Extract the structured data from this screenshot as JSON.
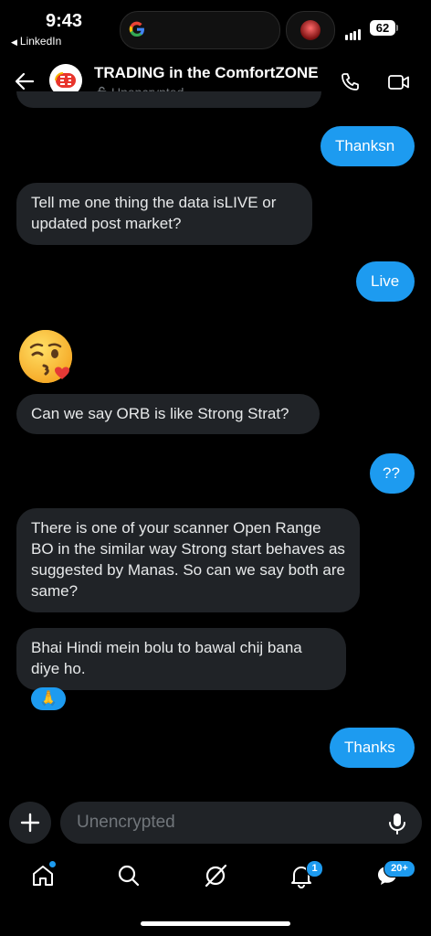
{
  "status_bar": {
    "time": "9:43",
    "back_app": "LinkedIn",
    "battery": "62"
  },
  "header": {
    "title": "TRADING in the ComfortZONE",
    "encryption": "Unencrypted"
  },
  "messages": [
    {
      "side": "out",
      "text": "Thanksn"
    },
    {
      "side": "in",
      "text": "Tell me one thing the data isLIVE or updated post market?"
    },
    {
      "side": "out",
      "text": "Live"
    },
    {
      "side": "in",
      "text": "😘"
    },
    {
      "side": "in",
      "text": "Can we say ORB is like Strong Strat?"
    },
    {
      "side": "out",
      "text": "??"
    },
    {
      "side": "in",
      "text": "There is one of your scanner Open Range BO in the similar way Strong start behaves as suggested by Manas. So can we say both are same?"
    },
    {
      "side": "in",
      "text": "Bhai Hindi mein bolu to bawal chij bana diye ho.",
      "reaction": "🙏"
    },
    {
      "side": "out",
      "text": "Thanks"
    }
  ],
  "composer": {
    "placeholder": "Unencrypted"
  },
  "nav": {
    "items": [
      "home-icon",
      "search-icon",
      "grok-icon",
      "notifications-icon",
      "messages-icon"
    ],
    "notifications_badge": "1",
    "messages_badge": "20+"
  },
  "colors": {
    "accent": "#1d9bf0",
    "incoming_bubble": "#202327",
    "background": "#000000"
  }
}
